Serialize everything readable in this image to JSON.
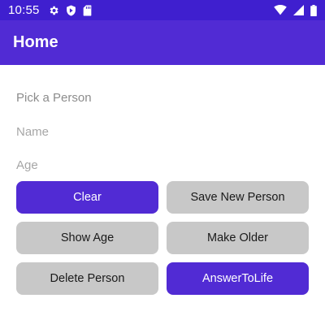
{
  "status_bar": {
    "time": "10:55",
    "left_icons": [
      "gear-icon",
      "shield-icon",
      "sd-card-icon"
    ],
    "right_icons": [
      "wifi-icon",
      "signal-icon",
      "battery-icon"
    ]
  },
  "app_bar": {
    "title": "Home"
  },
  "form": {
    "picker_label": "Pick a Person",
    "name_placeholder": "Name",
    "age_placeholder": "Age"
  },
  "buttons": {
    "clear": "Clear",
    "save_new_person": "Save New Person",
    "show_age": "Show Age",
    "make_older": "Make Older",
    "delete_person": "Delete Person",
    "answer_to_life": "AnswerToLife"
  },
  "colors": {
    "status_bar": "#3f1fcf",
    "primary": "#512bd4",
    "secondary_button": "#c8c8c8"
  }
}
